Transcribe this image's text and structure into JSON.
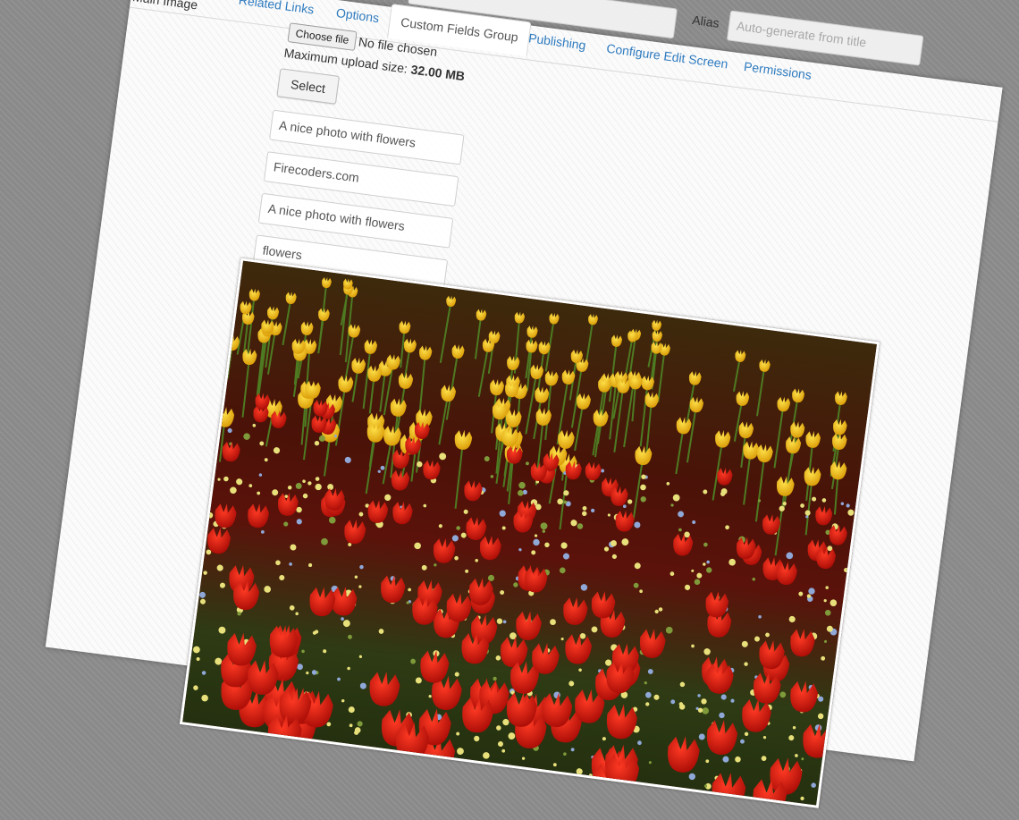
{
  "tabs": {
    "items": [
      {
        "label": "Related Links",
        "state": "normal"
      },
      {
        "label": "Options",
        "state": "normal"
      },
      {
        "label": "Custom Fields Group",
        "state": "active"
      },
      {
        "label": "Publishing",
        "state": "normal"
      },
      {
        "label": "Configure Edit Screen",
        "state": "normal"
      },
      {
        "label": "Permissions",
        "state": "normal"
      }
    ]
  },
  "alias": {
    "label": "Alias",
    "placeholder": "Auto-generate from title"
  },
  "main_image": {
    "label": "Main Image",
    "choose_file_label": "Choose file",
    "no_file_text": "No file chosen",
    "max_upload_prefix": "Maximum upload size:",
    "max_upload_value": "32.00 MB",
    "select_label": "Select",
    "fields": [
      "A nice photo with flowers",
      "Firecoders.com",
      "A nice photo with flowers",
      "flowers"
    ]
  },
  "colors": {
    "link": "#2f7bbf",
    "tulip_red": "#d2180f",
    "tulip_yellow": "#e8b90f",
    "foliage": "#4a6a1f"
  }
}
